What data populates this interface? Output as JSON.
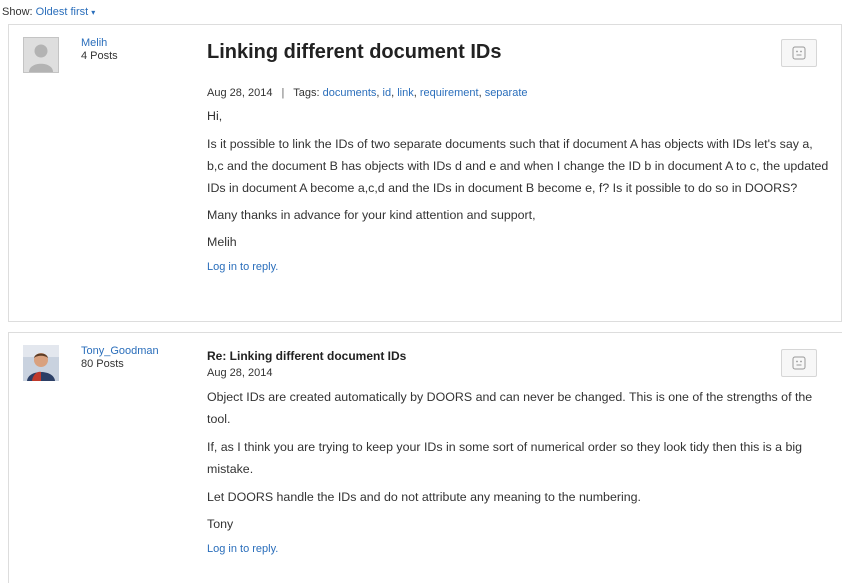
{
  "show": {
    "label": "Show:",
    "value": "Oldest first"
  },
  "posts": [
    {
      "author": "Melih",
      "post_count": "4 Posts",
      "title": "Linking different document IDs",
      "date": "Aug 28, 2014",
      "tags_label": "Tags:",
      "tags": [
        "documents",
        "id",
        "link",
        "requirement",
        "separate"
      ],
      "body": [
        "Hi,",
        "Is it possible to link the IDs of two separate documents such that if document A has objects with IDs let's say a, b,c and the document B has objects with IDs d and e and when I change the ID b in document A to c, the updated IDs in document A become a,c,d and the IDs in document B become e, f?  Is it possible to do so in DOORS?",
        "Many thanks in advance for your kind attention and support,",
        "Melih"
      ],
      "reply_link": "Log in to reply."
    },
    {
      "author": "Tony_Goodman",
      "post_count": "80 Posts",
      "title": "Re: Linking different document IDs",
      "date": "Aug 28, 2014",
      "body": [
        "Object IDs are created automatically by DOORS and can never be changed. This is one of the strengths of the tool.",
        "If, as I think you are trying to keep your IDs in some sort of numerical order so they look tidy then this is a big mistake.",
        "Let DOORS handle the IDs and do not attribute any meaning to the numbering.",
        "Tony"
      ],
      "reply_link": "Log in to reply."
    }
  ],
  "icons": {
    "react": "smiley-face-icon",
    "generic_avatar": "default-user-avatar",
    "photo_avatar": "user-photo-avatar"
  }
}
